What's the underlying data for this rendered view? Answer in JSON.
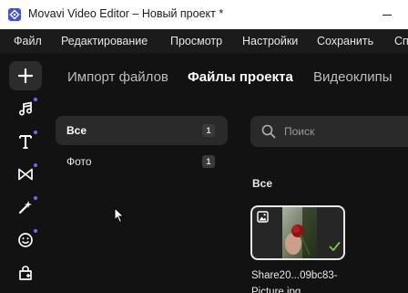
{
  "window": {
    "title": "Movavi Video Editor – Новый проект *",
    "app_icon": "movavi-logo-icon",
    "controls": [
      "minimize-icon"
    ]
  },
  "menu": {
    "items": [
      {
        "label": "Файл"
      },
      {
        "label": "Редактирование"
      },
      {
        "label": "Просмотр"
      },
      {
        "label": "Настройки"
      },
      {
        "label": "Сохранить"
      },
      {
        "label": "Сп"
      }
    ]
  },
  "toolbar": {
    "items": [
      {
        "icon": "plus-icon",
        "active": true
      },
      {
        "icon": "music-note-icon",
        "badge": true
      },
      {
        "icon": "text-icon",
        "badge": true
      },
      {
        "icon": "transitions-icon",
        "badge": true
      },
      {
        "icon": "magic-wand-icon",
        "badge": true
      },
      {
        "icon": "sticker-smiley-icon",
        "badge": true
      },
      {
        "icon": "effects-store-icon",
        "badge": false
      }
    ],
    "badge_color": "#8b5cf6"
  },
  "tabs": [
    {
      "label": "Импорт файлов",
      "active": false
    },
    {
      "label": "Файлы проекта",
      "active": true
    },
    {
      "label": "Видеоклипы",
      "active": false
    }
  ],
  "categories": [
    {
      "label": "Все",
      "count": "1",
      "active": true
    },
    {
      "label": "Фото",
      "count": "1",
      "active": false
    }
  ],
  "search": {
    "placeholder": "Поиск",
    "value": "",
    "icon": "search-icon"
  },
  "library": {
    "section_heading": "Все",
    "items": [
      {
        "file_name": "Share20...09bc83-Picture.jpg",
        "type_icon": "image-icon",
        "status_icon": "checkmark-icon",
        "selected": true
      }
    ]
  }
}
